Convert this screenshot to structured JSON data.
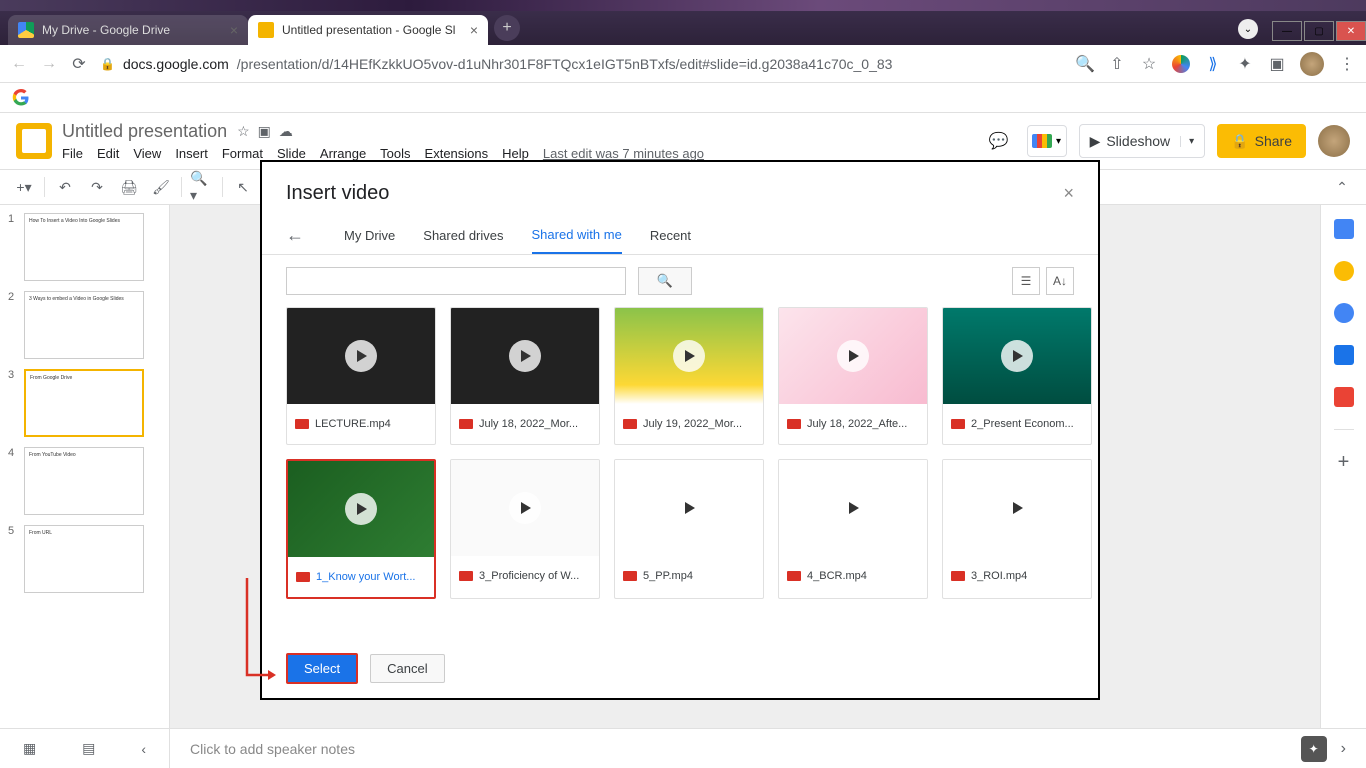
{
  "window": {
    "tabs": [
      {
        "title": "My Drive - Google Drive",
        "favicon_color": "#0f9d58"
      },
      {
        "title": "Untitled presentation - Google Sl",
        "favicon_color": "#f4b400"
      }
    ]
  },
  "address": {
    "domain": "docs.google.com",
    "path": "/presentation/d/14HEfKzkkUO5vov-d1uNhr301F8FTQcx1eIGT5nBTxfs/edit#slide=id.g2038a41c70c_0_83"
  },
  "slides": {
    "title": "Untitled presentation",
    "menu": [
      "File",
      "Edit",
      "View",
      "Insert",
      "Format",
      "Slide",
      "Arrange",
      "Tools",
      "Extensions",
      "Help"
    ],
    "last_edit": "Last edit was 7 minutes ago",
    "slideshow_label": "Slideshow",
    "share_label": "Share",
    "speaker_notes_placeholder": "Click to add speaker notes",
    "thumbnails": [
      {
        "num": "1",
        "text": "How To Insert a Video Into Google Slides"
      },
      {
        "num": "2",
        "text": "3 Ways to embed a Video in Google Slides"
      },
      {
        "num": "3",
        "text": "From Google Drive",
        "active": true
      },
      {
        "num": "4",
        "text": "From YouTube Video"
      },
      {
        "num": "5",
        "text": "From URL"
      }
    ]
  },
  "modal": {
    "title": "Insert video",
    "tabs": [
      "My Drive",
      "Shared drives",
      "Shared with me",
      "Recent"
    ],
    "active_tab": "Shared with me",
    "select_label": "Select",
    "cancel_label": "Cancel",
    "videos": [
      {
        "name": "LECTURE.mp4",
        "bg": "vp-dark"
      },
      {
        "name": "July 18, 2022_Mor...",
        "bg": "vp-dark"
      },
      {
        "name": "July 19, 2022_Mor...",
        "bg": "vp-green"
      },
      {
        "name": "July 18, 2022_Afte...",
        "bg": "vp-pink"
      },
      {
        "name": "2_Present Econom...",
        "bg": "vp-teal"
      },
      {
        "name": "1_Know your Wort...",
        "bg": "vp-darkgreen",
        "selected": true
      },
      {
        "name": "3_Proficiency of W...",
        "bg": "vp-light"
      },
      {
        "name": "5_PP.mp4",
        "bg": "vp-white"
      },
      {
        "name": "4_BCR.mp4",
        "bg": "vp-white"
      },
      {
        "name": "3_ROI.mp4",
        "bg": "vp-white"
      }
    ]
  }
}
